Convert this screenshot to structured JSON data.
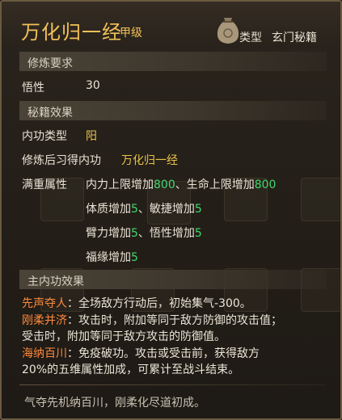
{
  "header": {
    "title": "万化归一经",
    "grade": "甲级",
    "type_label": "类型",
    "type_value": "玄门秘籍",
    "icon": "bag-icon"
  },
  "requirements": {
    "section_title": "修炼要求",
    "stat_label": "悟性",
    "stat_value": "30"
  },
  "effects": {
    "section_title": "秘籍效果",
    "internal_type_label": "内功类型",
    "internal_type_value": "阳",
    "learned_label": "修炼后习得内功",
    "learned_value": "万化归一经",
    "max_label": "满重属性",
    "attrs": [
      {
        "a_text": "内力上限增加",
        "a_val": "800",
        "sep": "、",
        "b_text": "生命上限增加",
        "b_val": "800"
      },
      {
        "a_text": "体质增加",
        "a_val": "5",
        "sep": "、",
        "b_text": "敏捷增加",
        "b_val": "5"
      },
      {
        "a_text": "臂力增加",
        "a_val": "5",
        "sep": "、",
        "b_text": "悟性增加",
        "b_val": "5"
      },
      {
        "a_text": "福缘增加",
        "a_val": "5",
        "sep": "",
        "b_text": "",
        "b_val": ""
      }
    ]
  },
  "main_effects": {
    "section_title": "主内功效果",
    "e1_name": "先声夺人",
    "e1_text": "：全场敌方行动后，初始集气-300。",
    "e2_name": "刚柔并济",
    "e2_text_1": "：攻击时，附加等同于敌方防御的攻击值；",
    "e2_text_2": "受击时，附加等同于敌方攻击的防御值。",
    "e3_name": "海纳百川",
    "e3_text_1": "：免疫破功。攻击或受击前，获得敌方",
    "e3_text_2": "20%的五维属性加成，可累计至战斗结束。"
  },
  "flavor_text": "气夺先机纳百川，刚柔化尽道初成。",
  "colors": {
    "title": "#f2c15a",
    "value_gold": "#e8c24c",
    "value_green": "#3fd96e",
    "effect_name": "#ff8a3c"
  }
}
